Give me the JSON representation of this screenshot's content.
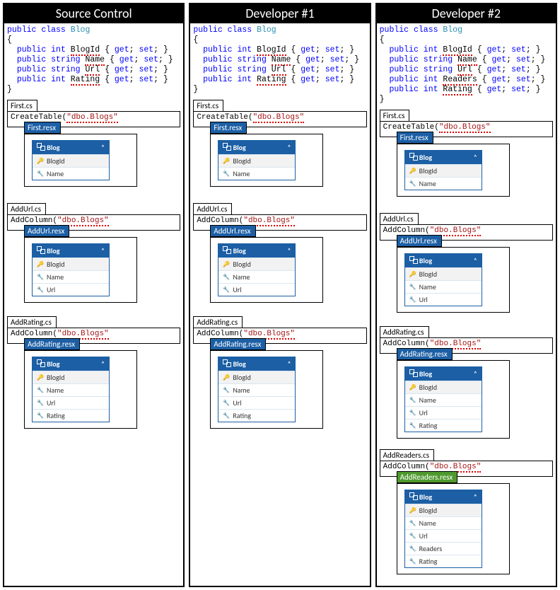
{
  "columns": [
    {
      "title": "Source Control",
      "code": {
        "class_kw": "public class",
        "class_name": "Blog",
        "open": "{",
        "props": [
          {
            "mods": "public",
            "type": "int",
            "name": "BlogId",
            "accessors": "{ get; set; }"
          },
          {
            "mods": "public",
            "type": "string",
            "name": "Name",
            "accessors": "{ get; set; }"
          },
          {
            "mods": "public",
            "type": "string",
            "name": "Url",
            "accessors": "{ get; set; }"
          },
          {
            "mods": "public",
            "type": "int",
            "name": "Rating",
            "accessors": "{ get; set; }"
          }
        ],
        "close": "}"
      },
      "migrations": [
        {
          "cs_tab": "First.cs",
          "cs_method": "CreateTable",
          "cs_arg": "\"dbo.Blogs\"",
          "resx_tab": "First.resx",
          "resx_green": false,
          "entity": {
            "name": "Blog",
            "fields": [
              "BlogId",
              "Name"
            ]
          },
          "spacer": 98
        },
        {
          "cs_tab": "AddUrl.cs",
          "cs_method": "AddColumn",
          "cs_arg": "\"dbo.Blogs\"",
          "resx_tab": "AddUrl.resx",
          "resx_green": false,
          "entity": {
            "name": "Blog",
            "fields": [
              "BlogId",
              "Name",
              "Url"
            ]
          },
          "spacer": 112
        },
        {
          "cs_tab": "AddRating.cs",
          "cs_method": "AddColumn",
          "cs_arg": "\"dbo.Blogs\"",
          "resx_tab": "AddRating.resx",
          "resx_green": false,
          "entity": {
            "name": "Blog",
            "fields": [
              "BlogId",
              "Name",
              "Url",
              "Rating"
            ]
          },
          "spacer": 126
        }
      ]
    },
    {
      "title": "Developer #1",
      "code": {
        "class_kw": "public class",
        "class_name": "Blog",
        "open": "{",
        "props": [
          {
            "mods": "public",
            "type": "int",
            "name": "BlogId",
            "accessors": "{ get; set; }"
          },
          {
            "mods": "public",
            "type": "string",
            "name": "Name",
            "accessors": "{ get; set; }"
          },
          {
            "mods": "public",
            "type": "string",
            "name": "Url",
            "accessors": "{ get; set; }"
          },
          {
            "mods": "public",
            "type": "int",
            "name": "Rating",
            "accessors": "{ get; set; }"
          }
        ],
        "close": "}"
      },
      "migrations": [
        {
          "cs_tab": "First.cs",
          "cs_method": "CreateTable",
          "cs_arg": "\"dbo.Blogs\"",
          "resx_tab": "First.resx",
          "resx_green": false,
          "entity": {
            "name": "Blog",
            "fields": [
              "BlogId",
              "Name"
            ]
          },
          "spacer": 98
        },
        {
          "cs_tab": "AddUrl.cs",
          "cs_method": "AddColumn",
          "cs_arg": "\"dbo.Blogs\"",
          "resx_tab": "AddUrl.resx",
          "resx_green": false,
          "entity": {
            "name": "Blog",
            "fields": [
              "BlogId",
              "Name",
              "Url"
            ]
          },
          "spacer": 112
        },
        {
          "cs_tab": "AddRating.cs",
          "cs_method": "AddColumn",
          "cs_arg": "\"dbo.Blogs\"",
          "resx_tab": "AddRating.resx",
          "resx_green": false,
          "entity": {
            "name": "Blog",
            "fields": [
              "BlogId",
              "Name",
              "Url",
              "Rating"
            ]
          },
          "spacer": 126
        }
      ]
    },
    {
      "title": "Developer #2",
      "code": {
        "class_kw": "public class",
        "class_name": "Blog",
        "open": "{",
        "props": [
          {
            "mods": "public",
            "type": "int",
            "name": "BlogId",
            "accessors": "{ get; set; }"
          },
          {
            "mods": "public",
            "type": "string",
            "name": "Name",
            "accessors": "{ get; set; }"
          },
          {
            "mods": "public",
            "type": "string",
            "name": "Url",
            "accessors": "{ get; set; }"
          },
          {
            "mods": "public",
            "type": "int",
            "name": "Readers",
            "accessors": "{ get; set; }"
          },
          {
            "mods": "public",
            "type": "int",
            "name": "Rating",
            "accessors": "{ get; set; }"
          }
        ],
        "close": "}"
      },
      "migrations": [
        {
          "cs_tab": "First.cs",
          "cs_method": "CreateTable",
          "cs_arg": "\"dbo.Blogs\"",
          "resx_tab": "First.resx",
          "resx_green": false,
          "entity": {
            "name": "Blog",
            "fields": [
              "BlogId",
              "Name"
            ]
          },
          "spacer": 98
        },
        {
          "cs_tab": "AddUrl.cs",
          "cs_method": "AddColumn",
          "cs_arg": "\"dbo.Blogs\"",
          "resx_tab": "AddUrl.resx",
          "resx_green": false,
          "entity": {
            "name": "Blog",
            "fields": [
              "BlogId",
              "Name",
              "Url"
            ]
          },
          "spacer": 112
        },
        {
          "cs_tab": "AddRating.cs",
          "cs_method": "AddColumn",
          "cs_arg": "\"dbo.Blogs\"",
          "resx_tab": "AddRating.resx",
          "resx_green": false,
          "entity": {
            "name": "Blog",
            "fields": [
              "BlogId",
              "Name",
              "Url",
              "Rating"
            ]
          },
          "spacer": 126
        },
        {
          "cs_tab": "AddReaders.cs",
          "cs_method": "AddColumn",
          "cs_arg": "\"dbo.Blogs\"",
          "resx_tab": "AddReaders.resx",
          "resx_green": true,
          "entity": {
            "name": "Blog",
            "fields": [
              "BlogId",
              "Name",
              "Url",
              "Readers",
              "Rating"
            ]
          },
          "spacer": 140
        }
      ]
    }
  ],
  "icons": {
    "key": "🔑",
    "wrench": "🔧",
    "chev": "˄"
  }
}
